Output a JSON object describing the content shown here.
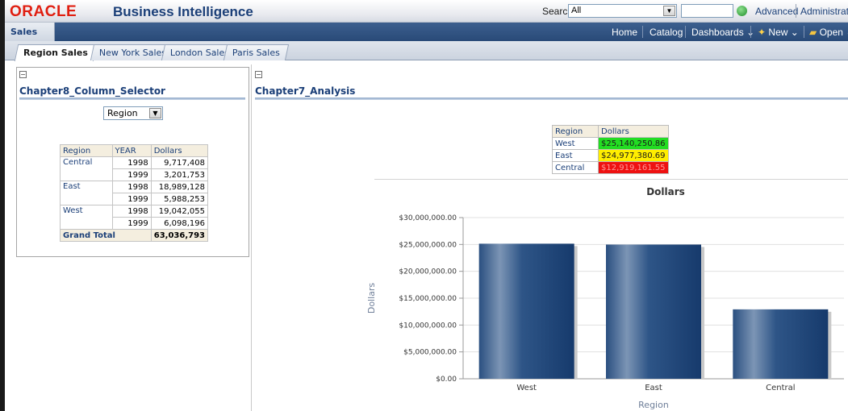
{
  "header": {
    "logo": "ORACLE",
    "app_title": "Business Intelligence",
    "search_label": "Search",
    "search_scope": "All",
    "advanced": "Advanced",
    "administration": "Administration"
  },
  "dashboard": {
    "name": "Sales",
    "nav": {
      "home": "Home",
      "catalog": "Catalog",
      "dashboards": "Dashboards",
      "new": "New",
      "open": "Open"
    },
    "tabs": [
      "Region Sales",
      "New York Sales",
      "London Sales",
      "Paris Sales"
    ]
  },
  "left_section": {
    "title": "Chapter8_Column_Selector",
    "selector_value": "Region",
    "pivot": {
      "headers": [
        "Region",
        "YEAR",
        "Dollars"
      ],
      "rows": [
        {
          "region": "Central",
          "years": [
            {
              "year": "1998",
              "dollars": "9,717,408"
            },
            {
              "year": "1999",
              "dollars": "3,201,753"
            }
          ]
        },
        {
          "region": "East",
          "years": [
            {
              "year": "1998",
              "dollars": "18,989,128"
            },
            {
              "year": "1999",
              "dollars": "5,988,253"
            }
          ]
        },
        {
          "region": "West",
          "years": [
            {
              "year": "1998",
              "dollars": "19,042,055"
            },
            {
              "year": "1999",
              "dollars": "6,098,196"
            }
          ]
        }
      ],
      "total_label": "Grand Total",
      "total_value": "63,036,793"
    }
  },
  "right_section": {
    "title": "Chapter7_Analysis",
    "status_table": {
      "headers": [
        "Region",
        "Dollars"
      ],
      "rows": [
        {
          "region": "West",
          "dollars": "$25,140,250.86",
          "color": "#22dd22",
          "text_color": "#1a1a1a"
        },
        {
          "region": "East",
          "dollars": "$24,977,380.69",
          "color": "#ffee00",
          "text_color": "#1a1a1a"
        },
        {
          "region": "Central",
          "dollars": "$12,919,161.55",
          "color": "#ee1111",
          "text_color": "#ff9a9a"
        }
      ]
    }
  },
  "chart_data": {
    "type": "bar",
    "title": "Dollars",
    "categories": [
      "West",
      "East",
      "Central"
    ],
    "values": [
      25140250.86,
      24977380.69,
      12919161.55
    ],
    "xlabel": "Region",
    "ylabel": "Dollars",
    "ylim": [
      0,
      30000000
    ],
    "ticks": [
      "$0.00",
      "$5,000,000.00",
      "$10,000,000.00",
      "$15,000,000.00",
      "$20,000,000.00",
      "$25,000,000.00",
      "$30,000,000.00"
    ],
    "grid": true,
    "bar_color": "#1f4a7e"
  }
}
